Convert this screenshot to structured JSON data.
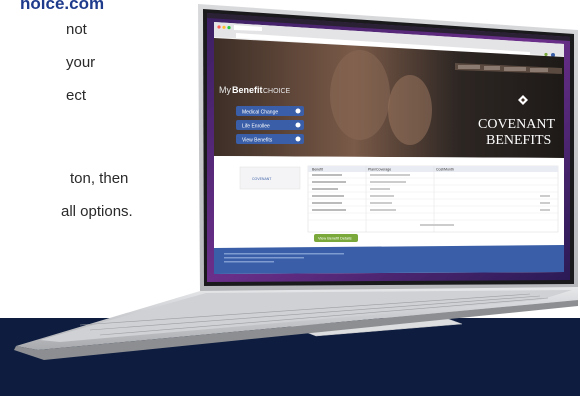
{
  "left_copy": {
    "url_fragment": "hoice.com",
    "lines": [
      "not",
      "your",
      "ect",
      "ton, then",
      " all options."
    ]
  },
  "site": {
    "logo_my": "My",
    "logo_benefit": "Benefit",
    "logo_choice": "CHOICE",
    "brand_line1": "COVENANT",
    "brand_line2": "BENEFITS",
    "nav_buttons": [
      "Medical Change",
      "Life Enrollee",
      "View Benefits"
    ],
    "top_links": [
      "Change Login",
      "Contact",
      "Help Desk",
      "Logout"
    ],
    "table_headers": [
      "Benefit",
      "Plan/Coverage",
      "Cost/Month"
    ],
    "cta": "View Benefit Details"
  },
  "colors": {
    "navy": "#0d1c3f",
    "link_blue": "#1f3b8c",
    "site_blue": "#3a5fa8",
    "green": "#7aa83b",
    "purple_wallpaper": "#5b2a7a"
  }
}
